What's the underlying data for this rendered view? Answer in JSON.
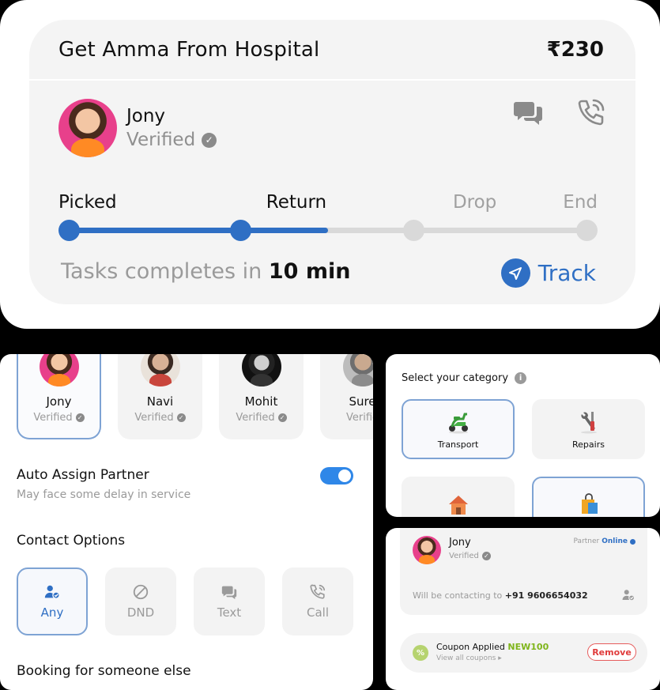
{
  "task": {
    "title": "Get Amma From Hospital",
    "price": "₹230",
    "driver_name": "Jony",
    "driver_status": "Verified",
    "steps": [
      {
        "label": "Picked",
        "done": true
      },
      {
        "label": "Return",
        "done": true
      },
      {
        "label": "Drop",
        "done": false
      },
      {
        "label": "End",
        "done": false
      }
    ],
    "progress": 0.5,
    "eta_prefix": "Tasks completes in ",
    "eta_value": "10 min",
    "track_label": "Track",
    "accent_color": "#2f6fc4"
  },
  "partners": [
    {
      "name": "Jony",
      "status": "Verified",
      "selected": true
    },
    {
      "name": "Navi",
      "status": "Verified",
      "selected": false
    },
    {
      "name": "Mohit",
      "status": "Verified",
      "selected": false
    },
    {
      "name": "Sure",
      "status": "Verifie",
      "selected": false
    }
  ],
  "auto_assign": {
    "title": "Auto Assign Partner",
    "subtitle": "May face some delay in service",
    "enabled": true
  },
  "contact_options": {
    "title": "Contact Options",
    "options": [
      {
        "label": "Any",
        "icon": "user-check-icon",
        "selected": true
      },
      {
        "label": "DND",
        "icon": "block-icon",
        "selected": false
      },
      {
        "label": "Text",
        "icon": "chat-icon",
        "selected": false
      },
      {
        "label": "Call",
        "icon": "phone-icon",
        "selected": false
      }
    ]
  },
  "booking_label": "Booking for someone else",
  "category": {
    "title": "Select your category",
    "items": [
      {
        "label": "Transport",
        "icon": "scooter-icon",
        "selected": true
      },
      {
        "label": "Repairs",
        "icon": "tools-icon",
        "selected": false
      },
      {
        "label": "",
        "icon": "house-icon",
        "selected": false
      },
      {
        "label": "",
        "icon": "shopping-bag-icon",
        "selected": true
      }
    ]
  },
  "contact_card": {
    "name": "Jony",
    "status": "Verified",
    "partner_label": "Partner",
    "online_label": "Online",
    "contact_prefix": "Will be contacting to ",
    "contact_number": "+91 9606654032"
  },
  "coupon": {
    "title": "Coupon Applied ",
    "code": "NEW100",
    "sub": "View all coupons ▸",
    "remove_label": "Remove"
  }
}
